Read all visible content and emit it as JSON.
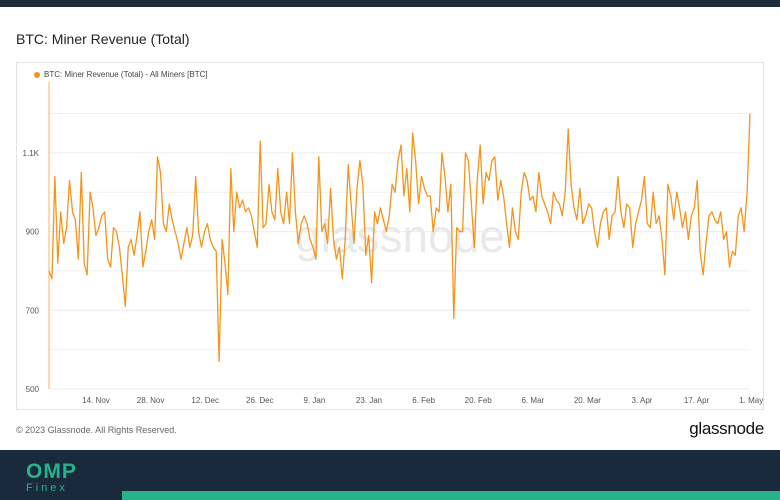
{
  "header": {
    "title": "BTC: Miner Revenue (Total)"
  },
  "footer": {
    "copyright": "© 2023 Glassnode. All Rights Reserved.",
    "brand": "glassnode",
    "logo_text": "OMP",
    "logo_subtext": "Finex"
  },
  "watermark": "glassnode",
  "colors": {
    "series": "#f7931a",
    "accent": "#27b38a",
    "footer_bg": "#182a3b"
  },
  "chart_data": {
    "type": "line",
    "title": "BTC: Miner Revenue (Total)",
    "legend_position": "top-left",
    "grid": true,
    "series": [
      {
        "name": "BTC: Miner Revenue (Total) - All Miners [BTC]",
        "x_start": "2022-11-02",
        "x_step_days": 1,
        "values": [
          800,
          780,
          1040,
          820,
          950,
          870,
          910,
          1030,
          950,
          930,
          830,
          1050,
          820,
          790,
          1000,
          960,
          890,
          910,
          940,
          950,
          830,
          810,
          910,
          900,
          860,
          790,
          710,
          860,
          880,
          840,
          890,
          950,
          810,
          850,
          900,
          930,
          880,
          1090,
          1050,
          920,
          900,
          970,
          930,
          900,
          870,
          830,
          870,
          910,
          860,
          890,
          1040,
          900,
          860,
          900,
          920,
          880,
          860,
          850,
          570,
          880,
          820,
          740,
          1060,
          900,
          1000,
          960,
          980,
          950,
          960,
          940,
          900,
          860,
          1130,
          910,
          920,
          1020,
          950,
          930,
          1060,
          950,
          920,
          1000,
          920,
          1100,
          950,
          870,
          920,
          940,
          920,
          880,
          860,
          830,
          1090,
          900,
          920,
          870,
          1010,
          880,
          830,
          860,
          780,
          880,
          1070,
          970,
          870,
          1010,
          1080,
          1020,
          840,
          890,
          770,
          950,
          920,
          960,
          930,
          900,
          940,
          1020,
          1000,
          1080,
          1120,
          990,
          1060,
          950,
          1150,
          1080,
          970,
          1040,
          1010,
          990,
          990,
          900,
          960,
          950,
          1100,
          1040,
          950,
          1020,
          680,
          910,
          900,
          900,
          1100,
          1080,
          970,
          860,
          1030,
          1120,
          970,
          1050,
          1030,
          1080,
          1090,
          980,
          1030,
          990,
          920,
          860,
          960,
          900,
          880,
          1000,
          1050,
          1030,
          980,
          990,
          950,
          1050,
          990,
          970,
          950,
          920,
          1000,
          980,
          970,
          940,
          1000,
          1160,
          1020,
          960,
          930,
          1010,
          920,
          940,
          970,
          960,
          900,
          860,
          920,
          950,
          960,
          880,
          940,
          950,
          1040,
          950,
          910,
          970,
          960,
          860,
          920,
          950,
          980,
          1040,
          920,
          910,
          1000,
          920,
          940,
          880,
          790,
          1020,
          990,
          930,
          1000,
          960,
          910,
          950,
          880,
          940,
          960,
          1030,
          850,
          790,
          870,
          940,
          950,
          930,
          920,
          950,
          880,
          900,
          810,
          850,
          840,
          940,
          960,
          900,
          1000,
          1200
        ]
      }
    ],
    "x_tick_labels": [
      "14. Nov",
      "28. Nov",
      "12. Dec",
      "26. Dec",
      "9. Jan",
      "23. Jan",
      "6. Feb",
      "20. Feb",
      "6. Mar",
      "20. Mar",
      "3. Apr",
      "17. Apr",
      "1. May"
    ],
    "y_tick_labels": [
      "500",
      "700",
      "900",
      "1.1K"
    ],
    "y_ticks": [
      500,
      700,
      900,
      1100
    ],
    "ylim": [
      500,
      1280
    ],
    "xlabel": "",
    "ylabel": ""
  }
}
